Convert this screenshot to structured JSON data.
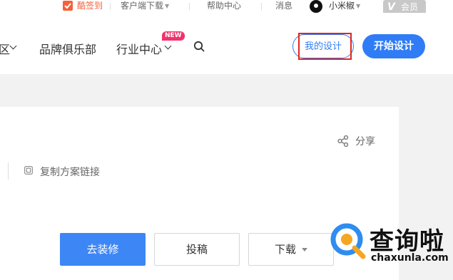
{
  "topbar": {
    "checkin": "酷签到",
    "client_download": "客户端下载",
    "help_center": "帮助中心",
    "messages": "消息",
    "username": "小米椒",
    "vip_label": "会员"
  },
  "nav": {
    "partial_item": "区",
    "brand_club": "品牌俱乐部",
    "industry_center": "行业中心",
    "new_badge": "NEW"
  },
  "header_buttons": {
    "my_design": "我的设计",
    "start_design": "开始设计"
  },
  "card": {
    "share": "分享",
    "copy_link": "复制方案链接",
    "buttons": {
      "decorate": "去装修",
      "submit": "投稿",
      "download": "下载"
    }
  },
  "watermark": {
    "title": "查询啦",
    "domain": "chaxunla.com"
  },
  "colors": {
    "accent": "#2f7cf6",
    "highlight": "#e3241d",
    "badge": "#f0336e",
    "checkin": "#f5603b"
  },
  "icons": [
    "check-icon",
    "chevron-down-icon",
    "avatar",
    "search-icon",
    "share-icon",
    "copy-icon",
    "caret-down-icon"
  ]
}
